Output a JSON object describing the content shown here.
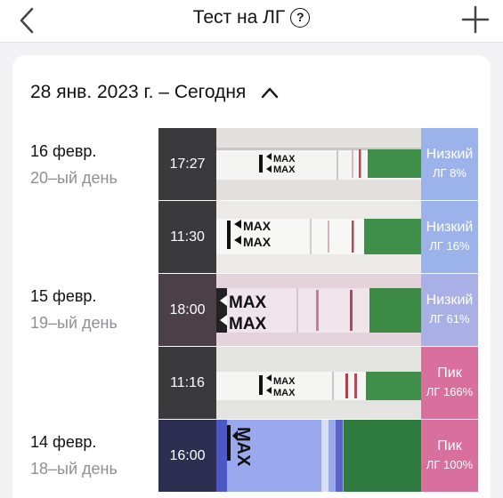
{
  "header": {
    "title": "Тест на ЛГ",
    "help_glyph": "?"
  },
  "date_range": {
    "label": "28 янв. 2023 г. – Сегодня"
  },
  "colors": {
    "low": "#9cb2ea",
    "peak": "#d86f9c",
    "strip_green": "#3f8f4a",
    "test_line": "#b2485a"
  },
  "days": [
    {
      "date": "16 февр.",
      "day_num": "20–ый день",
      "tests": [
        {
          "time": "17:27",
          "level": "Низкий",
          "pct": "ЛГ 8%",
          "result": "low"
        },
        {
          "time": "11:30",
          "level": "Низкий",
          "pct": "ЛГ 16%",
          "result": "low"
        }
      ]
    },
    {
      "date": "15 февр.",
      "day_num": "19–ый день",
      "tests": [
        {
          "time": "18:00",
          "level": "Низкий",
          "pct": "ЛГ 61%",
          "result": "low"
        },
        {
          "time": "11:16",
          "level": "Пик",
          "pct": "ЛГ 166%",
          "result": "peak"
        }
      ]
    },
    {
      "date": "14 февр.",
      "day_num": "18–ый день",
      "tests": [
        {
          "time": "16:00",
          "level": "Пик",
          "pct": "ЛГ 100%",
          "result": "peak"
        }
      ]
    }
  ],
  "strip_text": "MAX"
}
